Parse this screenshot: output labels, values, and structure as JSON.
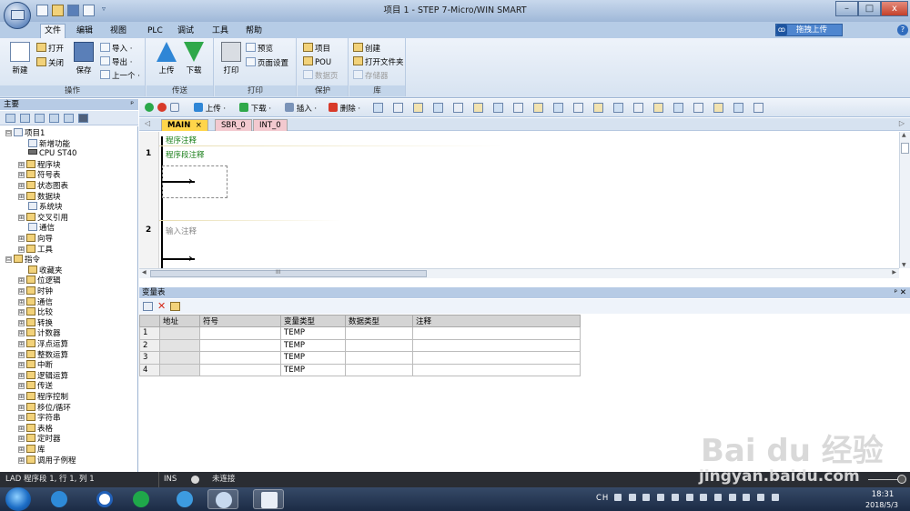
{
  "window": {
    "title": "项目 1 - STEP 7-Micro/WIN SMART",
    "min_glyph": "–",
    "max_glyph": "□",
    "close_glyph": "x"
  },
  "menu": [
    "文件",
    "编辑",
    "视图",
    "PLC",
    "调试",
    "工具",
    "帮助"
  ],
  "upload_drag": {
    "icon": "ꝏ",
    "label": "拖拽上传"
  },
  "help_glyph": "?",
  "ribbon": {
    "groups": [
      {
        "label": "操作",
        "items": {
          "new": "新建",
          "open": "打开",
          "close": "关闭",
          "save": "保存",
          "import": "导入 ·",
          "export": "导出 ·",
          "previous": "上一个 ·"
        }
      },
      {
        "label": "传送",
        "items": {
          "upload": "上传",
          "download": "下载"
        }
      },
      {
        "label": "打印",
        "items": {
          "print": "打印",
          "preview": "预览",
          "page_setup": "页面设置"
        }
      },
      {
        "label": "保护",
        "items": {
          "project": "项目",
          "pou": "POU",
          "data_page": "数据页"
        }
      },
      {
        "label": "库",
        "items": {
          "create": "创建",
          "open_folder": "打开文件夹",
          "memory": "存储器"
        }
      }
    ]
  },
  "nav": {
    "header": "主要",
    "pin_glyph": "ᵖ",
    "tree": [
      {
        "label": "项目1",
        "depth": 0,
        "expander": "⊟",
        "icon": "doc"
      },
      {
        "label": "新增功能",
        "depth": 1,
        "expander": "",
        "icon": "doc"
      },
      {
        "label": "CPU ST40",
        "depth": 1,
        "expander": "",
        "icon": "cpu"
      },
      {
        "label": "程序块",
        "depth": 1,
        "expander": "⊞",
        "icon": "folder"
      },
      {
        "label": "符号表",
        "depth": 1,
        "expander": "⊞",
        "icon": "folder"
      },
      {
        "label": "状态图表",
        "depth": 1,
        "expander": "⊞",
        "icon": "folder"
      },
      {
        "label": "数据块",
        "depth": 1,
        "expander": "⊞",
        "icon": "folder"
      },
      {
        "label": "系统块",
        "depth": 1,
        "expander": "",
        "icon": "doc"
      },
      {
        "label": "交叉引用",
        "depth": 1,
        "expander": "⊞",
        "icon": "folder"
      },
      {
        "label": "通信",
        "depth": 1,
        "expander": "",
        "icon": "doc"
      },
      {
        "label": "向导",
        "depth": 1,
        "expander": "⊞",
        "icon": "folder"
      },
      {
        "label": "工具",
        "depth": 1,
        "expander": "⊞",
        "icon": "folder"
      },
      {
        "label": "指令",
        "depth": 0,
        "expander": "⊟",
        "icon": "folder"
      },
      {
        "label": "收藏夹",
        "depth": 1,
        "expander": "",
        "icon": "folder"
      },
      {
        "label": "位逻辑",
        "depth": 1,
        "expander": "⊞",
        "icon": "folder"
      },
      {
        "label": "时钟",
        "depth": 1,
        "expander": "⊞",
        "icon": "folder"
      },
      {
        "label": "通信",
        "depth": 1,
        "expander": "⊞",
        "icon": "folder"
      },
      {
        "label": "比较",
        "depth": 1,
        "expander": "⊞",
        "icon": "folder"
      },
      {
        "label": "转换",
        "depth": 1,
        "expander": "⊞",
        "icon": "folder"
      },
      {
        "label": "计数器",
        "depth": 1,
        "expander": "⊞",
        "icon": "folder"
      },
      {
        "label": "浮点运算",
        "depth": 1,
        "expander": "⊞",
        "icon": "folder"
      },
      {
        "label": "整数运算",
        "depth": 1,
        "expander": "⊞",
        "icon": "folder"
      },
      {
        "label": "中断",
        "depth": 1,
        "expander": "⊞",
        "icon": "folder"
      },
      {
        "label": "逻辑运算",
        "depth": 1,
        "expander": "⊞",
        "icon": "folder"
      },
      {
        "label": "传送",
        "depth": 1,
        "expander": "⊞",
        "icon": "folder"
      },
      {
        "label": "程序控制",
        "depth": 1,
        "expander": "⊞",
        "icon": "folder"
      },
      {
        "label": "移位/循环",
        "depth": 1,
        "expander": "⊞",
        "icon": "folder"
      },
      {
        "label": "字符串",
        "depth": 1,
        "expander": "⊞",
        "icon": "folder"
      },
      {
        "label": "表格",
        "depth": 1,
        "expander": "⊞",
        "icon": "folder"
      },
      {
        "label": "定时器",
        "depth": 1,
        "expander": "⊞",
        "icon": "folder"
      },
      {
        "label": "库",
        "depth": 1,
        "expander": "⊞",
        "icon": "folder"
      },
      {
        "label": "调用子例程",
        "depth": 1,
        "expander": "⊞",
        "icon": "folder"
      }
    ]
  },
  "editor_toolbar": {
    "upload": "上传 ·",
    "download": "下载 ·",
    "insert": "插入 ·",
    "delete": "删除 ·"
  },
  "pou_tabs": [
    {
      "label": "MAIN",
      "close": "×",
      "active": true
    },
    {
      "label": "SBR_0",
      "close": "",
      "active": false
    },
    {
      "label": "INT_0",
      "close": "",
      "active": false
    }
  ],
  "ladder": {
    "program_comment": "程序注释",
    "rungs": [
      {
        "number": "1",
        "comment": "程序段注释"
      },
      {
        "number": "2",
        "comment": "输入注释"
      }
    ],
    "hscroll_marker": "III"
  },
  "var_table": {
    "title": "变量表",
    "panel_glyph": "ᵖ ✕",
    "columns": [
      "",
      "地址",
      "符号",
      "变量类型",
      "数据类型",
      "注释"
    ],
    "rows": [
      {
        "n": "1",
        "addr": "",
        "symbol": "",
        "var_type": "TEMP",
        "data_type": "",
        "comment": ""
      },
      {
        "n": "2",
        "addr": "",
        "symbol": "",
        "var_type": "TEMP",
        "data_type": "",
        "comment": ""
      },
      {
        "n": "3",
        "addr": "",
        "symbol": "",
        "var_type": "TEMP",
        "data_type": "",
        "comment": ""
      },
      {
        "n": "4",
        "addr": "",
        "symbol": "",
        "var_type": "TEMP",
        "data_type": "",
        "comment": ""
      }
    ]
  },
  "status": {
    "position": "LAD 程序段 1, 行 1, 列 1",
    "mode": "INS",
    "connection": "未连接"
  },
  "taskbar": {
    "tray_text": "CH",
    "time": "18:31",
    "date": "2018/5/3"
  },
  "watermark": {
    "logo": "Bai du 经验",
    "url": "jingyan.baidu.com"
  },
  "colors": {
    "ribbon_bg": "#dbe6f3",
    "menu_bg": "#b6cce6",
    "upload_btn": "#4f86cf",
    "close_btn": "#c4402a",
    "comment_green": "#1a7f1a",
    "main_tab": "#ffd54a",
    "other_tab": "#f3c9cf",
    "status_bg": "#2a2d33"
  }
}
